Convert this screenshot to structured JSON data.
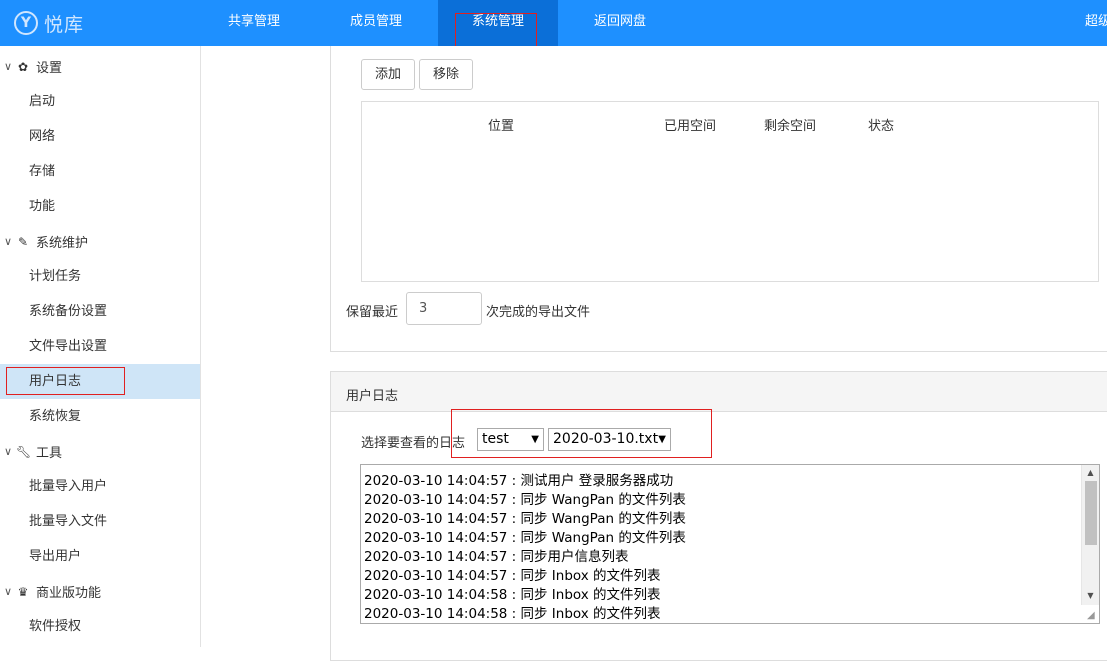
{
  "app": {
    "logo_glyph": "Y",
    "logo_text": "悦库"
  },
  "topnav": {
    "items": [
      {
        "label": "共享管理"
      },
      {
        "label": "成员管理"
      },
      {
        "label": "系统管理"
      },
      {
        "label": "返回网盘"
      }
    ],
    "right_label": "超级"
  },
  "sidebar": {
    "groups": [
      {
        "label": "设置",
        "icon": "gear-icon",
        "items": [
          "启动",
          "网络",
          "存储",
          "功能"
        ]
      },
      {
        "label": "系统维护",
        "icon": "brush-icon",
        "items": [
          "计划任务",
          "系统备份设置",
          "文件导出设置",
          "用户日志",
          "系统恢复"
        ]
      },
      {
        "label": "工具",
        "icon": "wrench-icon",
        "items": [
          "批量导入用户",
          "批量导入文件",
          "导出用户"
        ]
      },
      {
        "label": "商业版功能",
        "icon": "crown-icon",
        "items": [
          "软件授权"
        ]
      }
    ]
  },
  "export_panel": {
    "add_label": "添加",
    "remove_label": "移除",
    "columns": [
      "位置",
      "已用空间",
      "剩余空间",
      "状态"
    ],
    "keep_prefix": "保留最近",
    "keep_value": "3",
    "keep_suffix": "次完成的导出文件"
  },
  "log_panel": {
    "title": "用户日志",
    "select_label": "选择要查看的日志",
    "user_select": "test",
    "file_select": "2020-03-10.txt",
    "lines": [
      "2020-03-10 14:04:57 : 测试用户 登录服务器成功",
      "2020-03-10 14:04:57 :  同步 WangPan 的文件列表",
      "2020-03-10 14:04:57 :  同步 WangPan 的文件列表",
      "2020-03-10 14:04:57 :  同步 WangPan 的文件列表",
      "2020-03-10 14:04:57 :  同步用户信息列表",
      "2020-03-10 14:04:57 :  同步 Inbox 的文件列表",
      "2020-03-10 14:04:58 :  同步 Inbox 的文件列表",
      "2020-03-10 14:04:58 :  同步 Inbox 的文件列表"
    ]
  }
}
